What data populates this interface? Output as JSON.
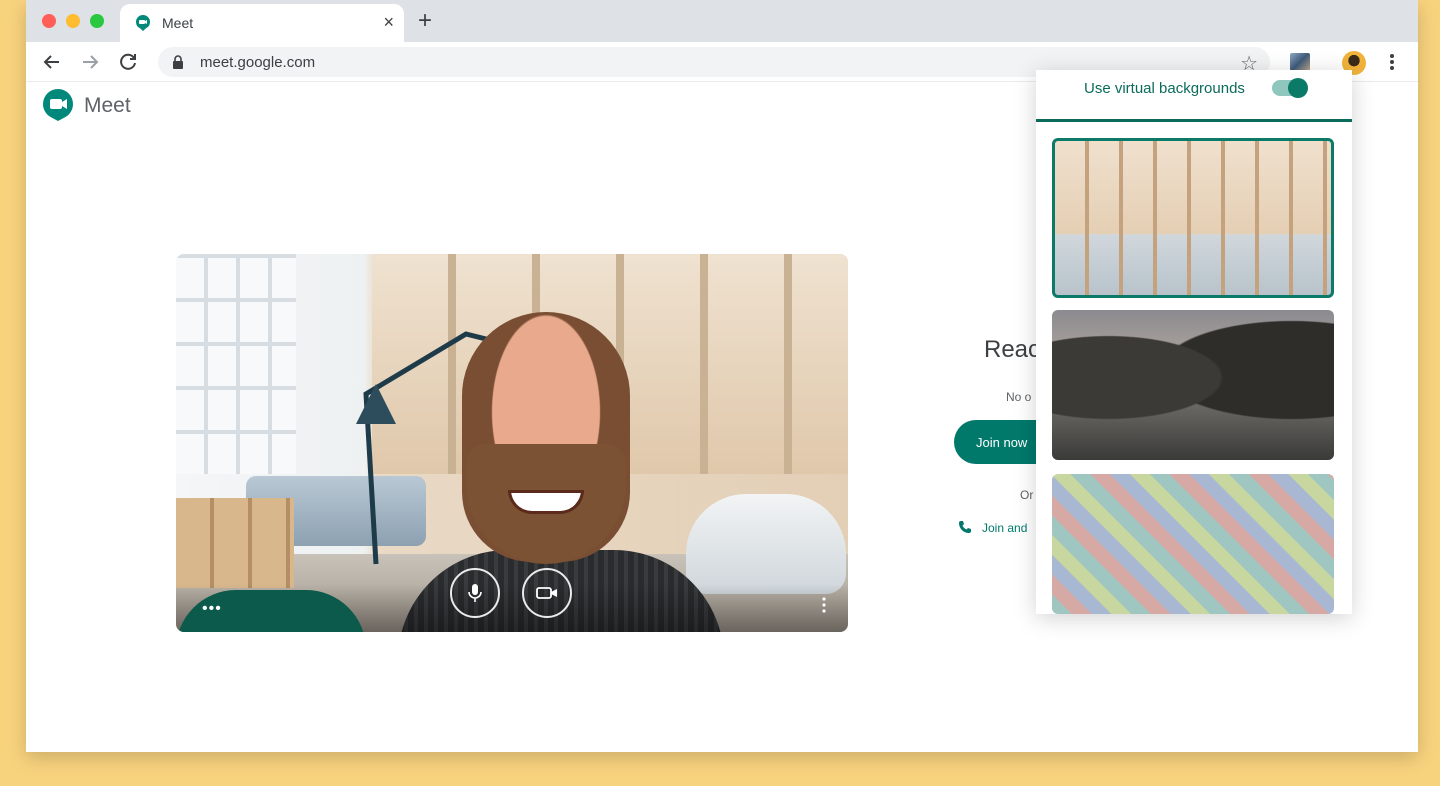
{
  "tab": {
    "title": "Meet",
    "close": "×",
    "new_tab": "+"
  },
  "address_bar": {
    "url": "meet.google.com",
    "star": "☆"
  },
  "meet": {
    "brand": "Meet"
  },
  "join_panel": {
    "ready_text": "Reac",
    "status_text": "No o",
    "join_button": "Join now",
    "or_text": "Or",
    "phone_link": "Join and"
  },
  "preview": {
    "more_label": "•••"
  },
  "virtual_backgrounds": {
    "title": "Use virtual backgrounds",
    "enabled": true,
    "options": [
      {
        "name": "office-background",
        "selected": true
      },
      {
        "name": "sea-rocks-background",
        "selected": false
      },
      {
        "name": "tiles-background",
        "selected": false
      }
    ]
  },
  "colors": {
    "accent": "#00796b",
    "backdrop": "#f8d37e"
  }
}
